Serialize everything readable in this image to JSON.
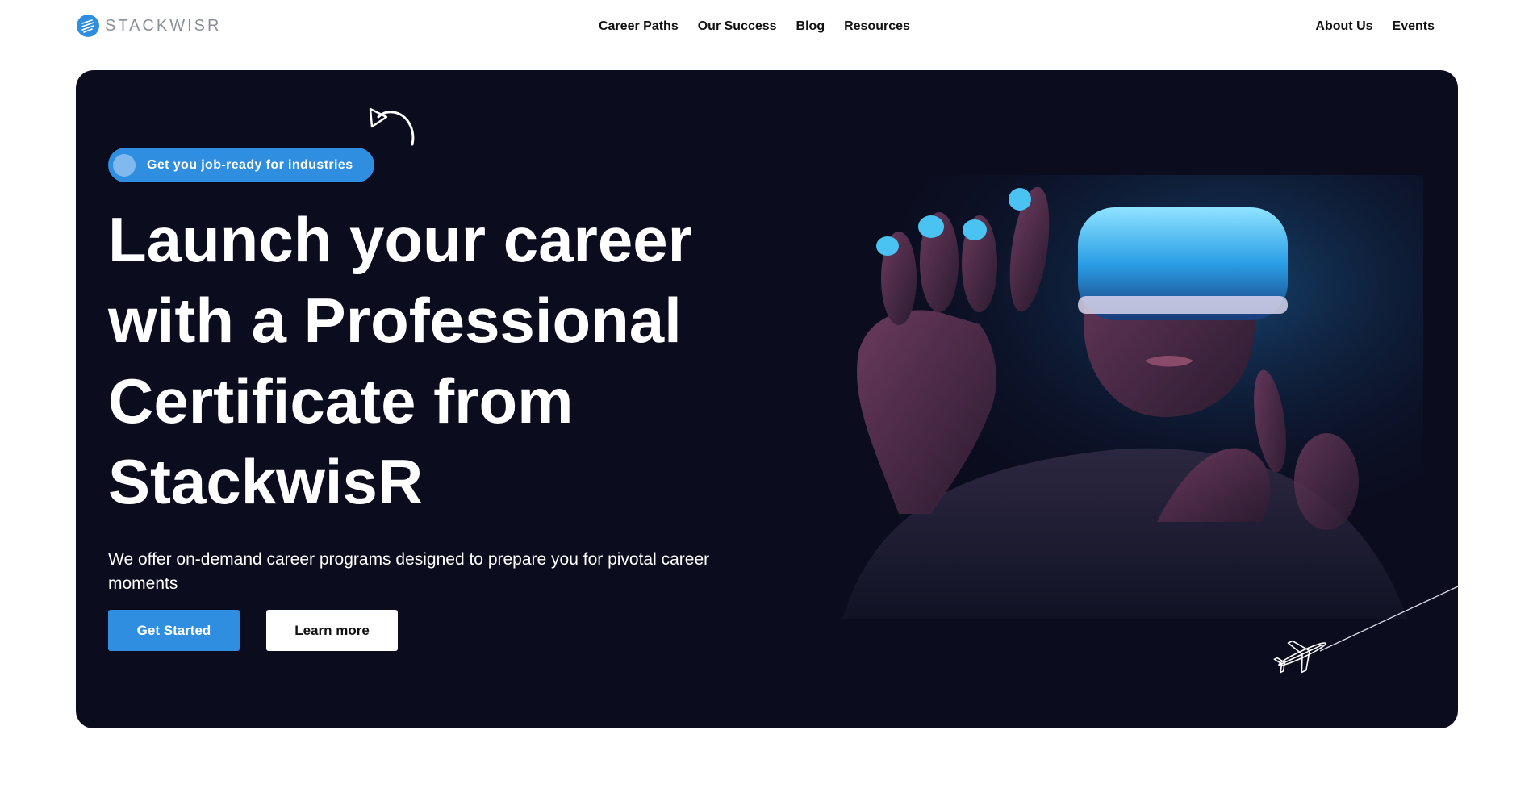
{
  "brand": {
    "name": "STACKWISR",
    "accent": "#2f8ee0"
  },
  "nav": {
    "center": [
      "Career Paths",
      "Our Success",
      "Blog",
      "Resources"
    ],
    "right": [
      "About Us",
      "Events"
    ]
  },
  "hero": {
    "background": "#0b0c1e",
    "badge": "Get you job-ready for industries",
    "headline": [
      "Launch your career",
      "with a Professional",
      "Certificate from",
      "StackwisR"
    ],
    "subtext": "We offer on-demand career programs designed to prepare you for pivotal career moments",
    "cta_primary": "Get Started",
    "cta_secondary": "Learn more"
  },
  "icons": {
    "logo": "stackwisr-logo-icon",
    "curl_arrow": "curved-arrow-icon",
    "airplane": "airplane-icon",
    "hero_image": "vr-headset-person-photo"
  }
}
